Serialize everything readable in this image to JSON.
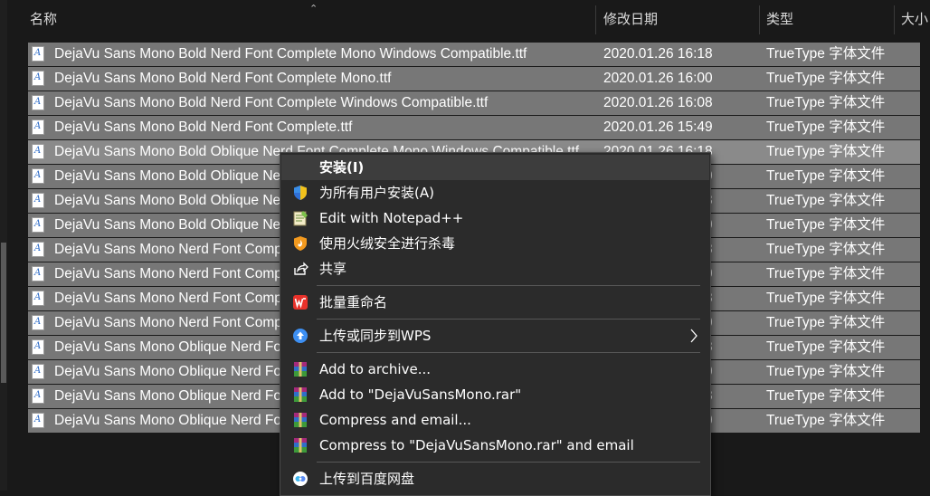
{
  "columns": {
    "name": "名称",
    "date": "修改日期",
    "type": "类型",
    "size": "大小"
  },
  "files": [
    {
      "name": "DejaVu Sans Mono Bold Nerd Font Complete Mono Windows Compatible.ttf",
      "date": "2020.01.26 16:18",
      "type": "TrueType 字体文件"
    },
    {
      "name": "DejaVu Sans Mono Bold Nerd Font Complete Mono.ttf",
      "date": "2020.01.26 16:00",
      "type": "TrueType 字体文件"
    },
    {
      "name": "DejaVu Sans Mono Bold Nerd Font Complete Windows Compatible.ttf",
      "date": "2020.01.26 16:08",
      "type": "TrueType 字体文件"
    },
    {
      "name": "DejaVu Sans Mono Bold Nerd Font Complete.ttf",
      "date": "2020.01.26 15:49",
      "type": "TrueType 字体文件"
    },
    {
      "name": "DejaVu Sans Mono Bold Oblique Nerd Font Complete Mono Windows Compatible.ttf",
      "date": "2020.01.26 16:18",
      "type": "TrueType 字体文件"
    },
    {
      "name": "DejaVu Sans Mono Bold Oblique Nerd Font Complete Mono.ttf",
      "date": "2020.01.26 16:00",
      "type": "TrueType 字体文件"
    },
    {
      "name": "DejaVu Sans Mono Bold Oblique Nerd Font Complete Windows Compatible.ttf",
      "date": "2020.01.26 16:08",
      "type": "TrueType 字体文件"
    },
    {
      "name": "DejaVu Sans Mono Bold Oblique Nerd Font Complete.ttf",
      "date": "2020.01.26 15:50",
      "type": "TrueType 字体文件"
    },
    {
      "name": "DejaVu Sans Mono Nerd Font Complete Mono Windows Compatible.ttf",
      "date": "2020.01.26 16:18",
      "type": "TrueType 字体文件"
    },
    {
      "name": "DejaVu Sans Mono Nerd Font Complete Mono.ttf",
      "date": "2020.01.26 16:00",
      "type": "TrueType 字体文件"
    },
    {
      "name": "DejaVu Sans Mono Nerd Font Complete Windows Compatible.ttf",
      "date": "2020.01.26 16:08",
      "type": "TrueType 字体文件"
    },
    {
      "name": "DejaVu Sans Mono Nerd Font Complete.ttf",
      "date": "2020.01.26 15:50",
      "type": "TrueType 字体文件"
    },
    {
      "name": "DejaVu Sans Mono Oblique Nerd Font Complete Mono Windows Compatible.ttf",
      "date": "2020.01.26 16:18",
      "type": "TrueType 字体文件"
    },
    {
      "name": "DejaVu Sans Mono Oblique Nerd Font Complete Mono.ttf",
      "date": "2020.01.26 16:00",
      "type": "TrueType 字体文件"
    },
    {
      "name": "DejaVu Sans Mono Oblique Nerd Font Complete Windows Compatible.ttf",
      "date": "2020.01.26 16:08",
      "type": "TrueType 字体文件"
    },
    {
      "name": "DejaVu Sans Mono Oblique Nerd Font Complete.ttf",
      "date": "2020.01.26 15:50",
      "type": "TrueType 字体文件"
    }
  ],
  "menu": {
    "install": "安装(I)",
    "install_all": "为所有用户安装(A)",
    "notepad": "Edit with Notepad++",
    "scan": "使用火绒安全进行杀毒",
    "share": "共享",
    "rename": "批量重命名",
    "wps": "上传或同步到WPS",
    "archive": "Add to archive...",
    "add_rar": "Add to \"DejaVuSansMono.rar\"",
    "compress_email": "Compress and email...",
    "compress_rar_email": "Compress to \"DejaVuSansMono.rar\" and email",
    "baidu": "上传到百度网盘"
  },
  "colors": {
    "background": "#191919",
    "selected_row": "#777777",
    "menu_bg": "#2b2b2b"
  },
  "icons": {
    "sort": "sort-ascending-icon",
    "file": "ttf-file-icon",
    "shield": "uac-shield-icon",
    "notepad": "notepad-icon",
    "huorong": "huorong-icon",
    "share": "share-icon",
    "wps": "wps-icon",
    "cloud": "cloud-upload-icon",
    "winrar": "winrar-icon",
    "baidu": "baidu-netdisk-icon",
    "chevron": "chevron-right-icon"
  }
}
